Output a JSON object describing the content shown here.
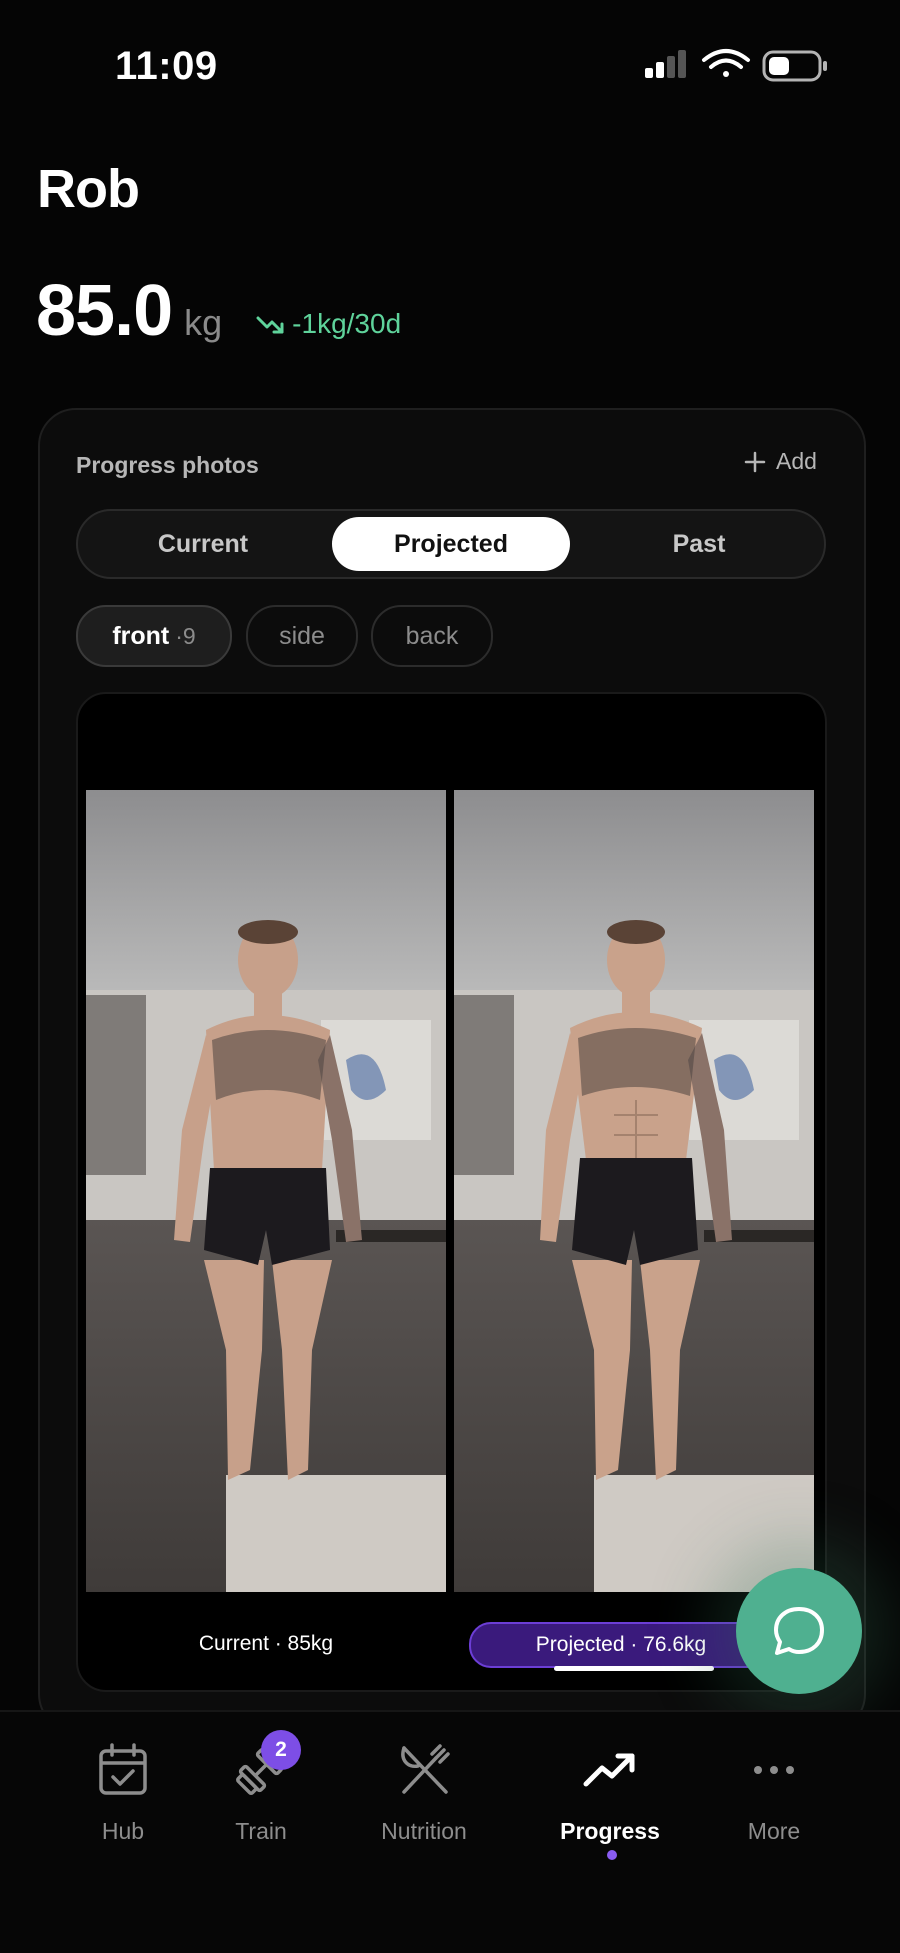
{
  "status_bar": {
    "time": "11:09"
  },
  "header": {
    "name": "Rob",
    "weight_value": "85.0",
    "weight_unit": "kg",
    "trend_text": "-1kg/30d"
  },
  "progress_photos": {
    "title": "Progress photos",
    "add_label": "Add",
    "tabs": [
      {
        "label": "Current",
        "selected": false
      },
      {
        "label": "Projected",
        "selected": true
      },
      {
        "label": "Past",
        "selected": false
      }
    ],
    "views": [
      {
        "label": "front",
        "count": "·9",
        "selected": true
      },
      {
        "label": "side",
        "selected": false
      },
      {
        "label": "back",
        "selected": false
      }
    ],
    "current_caption": "Current · 85kg",
    "projected_caption": "Projected · 76.6kg"
  },
  "bottom_nav": {
    "items": [
      {
        "label": "Hub",
        "icon": "calendar-check-icon"
      },
      {
        "label": "Train",
        "icon": "dumbbell-icon",
        "badge": "2"
      },
      {
        "label": "Nutrition",
        "icon": "fork-knife-icon"
      },
      {
        "label": "Progress",
        "icon": "trending-up-icon",
        "active": true
      },
      {
        "label": "More",
        "icon": "more-dots-icon"
      }
    ]
  },
  "colors": {
    "accent_purple": "#7d4ee6",
    "trend_green": "#5fd39b",
    "chat_fab": "#4fb090",
    "background": "#050505"
  }
}
